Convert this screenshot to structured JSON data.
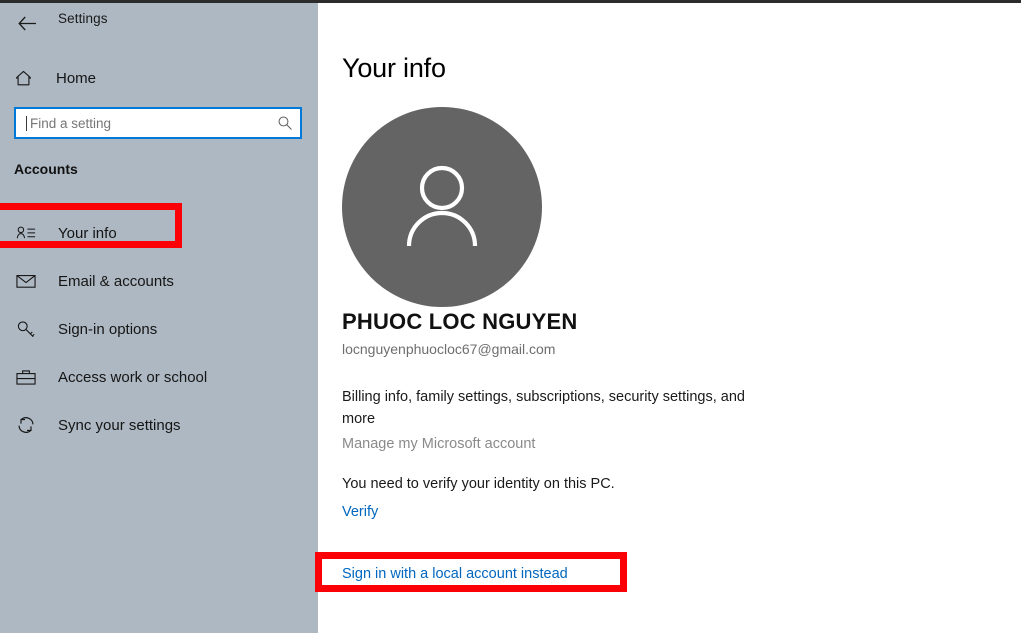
{
  "window": {
    "title": "Settings",
    "back_icon": "back-arrow-icon",
    "controls": {
      "minimize": "−",
      "maximize": "□",
      "close": "✕"
    }
  },
  "sidebar": {
    "home": {
      "label": "Home",
      "icon": "home-icon"
    },
    "search": {
      "placeholder": "Find a setting",
      "value": "",
      "icon": "search-icon"
    },
    "section_heading": "Accounts",
    "items": [
      {
        "label": "Your info",
        "icon": "user-card-icon",
        "selected": true
      },
      {
        "label": "Email & accounts",
        "icon": "envelope-icon",
        "selected": false
      },
      {
        "label": "Sign-in options",
        "icon": "key-icon",
        "selected": false
      },
      {
        "label": "Access work or school",
        "icon": "briefcase-icon",
        "selected": false
      },
      {
        "label": "Sync your settings",
        "icon": "sync-icon",
        "selected": false
      }
    ]
  },
  "main": {
    "page_title": "Your info",
    "avatar_icon": "person-placeholder-icon",
    "user_name": "PHUOC LOC NGUYEN",
    "user_email": "locnguyenphuocloc67@gmail.com",
    "billing_text": "Billing info, family settings, subscriptions, security settings, and more",
    "manage_account_link": "Manage my Microsoft account",
    "verify_prompt": "You need to verify your identity on this PC.",
    "verify_link": "Verify",
    "local_account_link": "Sign in with a local account instead"
  },
  "colors": {
    "sidebar_bg": "#aeb8c2",
    "content_bg": "#ffffff",
    "accent_blue": "#0078d7",
    "link_blue": "#0067c0",
    "disabled_gray": "#8a8a8a",
    "avatar_gray": "#646464",
    "annotation_red": "#fb0007"
  }
}
